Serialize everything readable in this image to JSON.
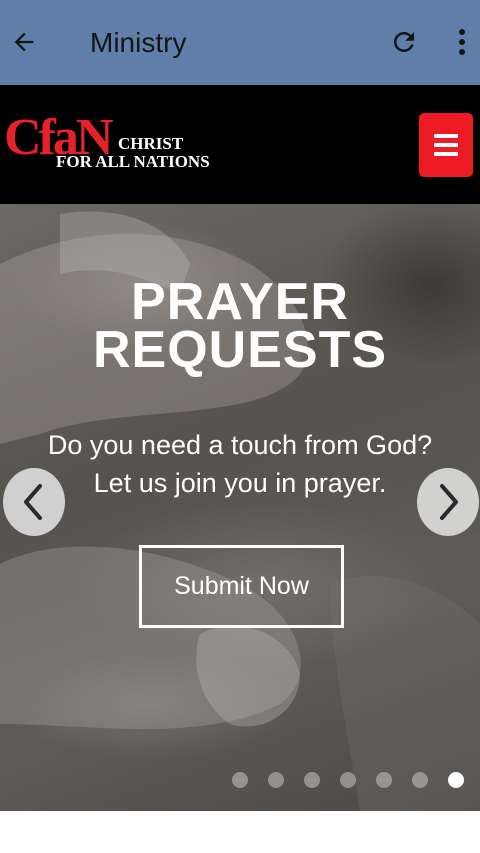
{
  "appbar": {
    "title": "Ministry",
    "icons": [
      "back-arrow-icon",
      "refresh-icon",
      "more-vert-icon"
    ],
    "color": "#5f7ea9"
  },
  "site_header": {
    "logo_mark": "CfaN",
    "logo_line1": "CHRIST",
    "logo_line2": "FOR ALL NATIONS",
    "menu_icon": "hamburger-icon",
    "accent_color": "#ed1c24"
  },
  "hero": {
    "heading_line1": "PRAYER",
    "heading_line2": "REQUESTS",
    "sub_line1": "Do you need a touch from God?",
    "sub_line2": "Let us join you in prayer.",
    "button_label": "Submit Now",
    "prev_icon": "chevron-left-icon",
    "next_icon": "chevron-right-icon",
    "slides_total": 7,
    "active_slide": 7
  }
}
